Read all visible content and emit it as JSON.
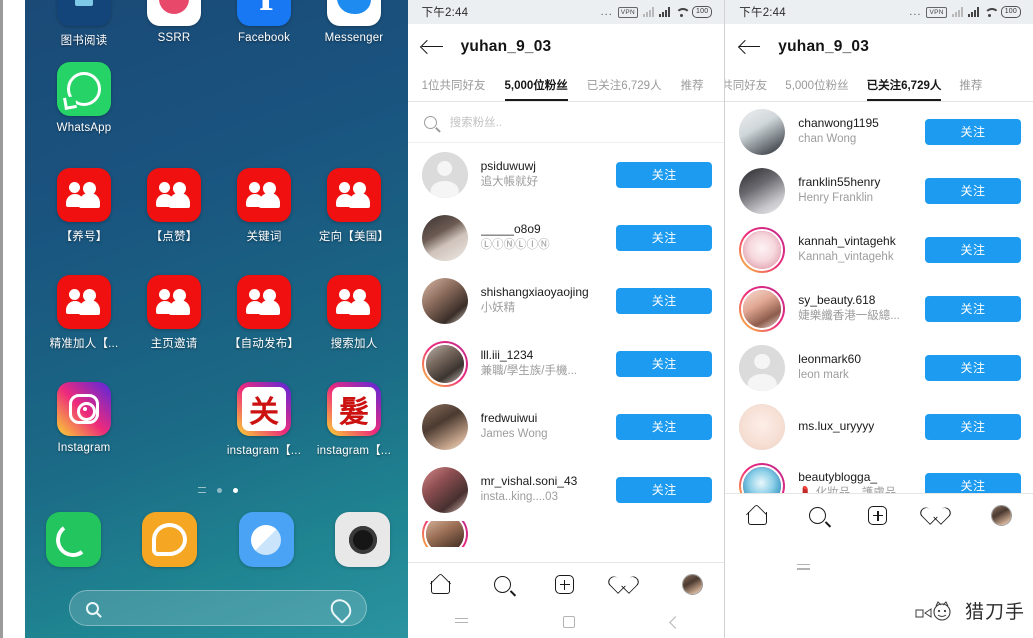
{
  "left_panel": {
    "name": "android-home-screen",
    "wallpaper_color": "#1b4a77",
    "app_rows": [
      [
        {
          "label": "图书阅读",
          "icon": "books-icon"
        },
        {
          "label": "SSRR",
          "icon": "ssrr-icon"
        },
        {
          "label": "Facebook",
          "icon": "facebook-icon"
        },
        {
          "label": "Messenger",
          "icon": "messenger-icon"
        }
      ],
      [
        {
          "label": "WhatsApp",
          "icon": "whatsapp-icon"
        }
      ],
      [
        {
          "label": "【养号】",
          "icon": "users-icon"
        },
        {
          "label": "【点赞】",
          "icon": "users-icon"
        },
        {
          "label": "关键词",
          "icon": "users-icon"
        },
        {
          "label": "定向【美国】",
          "icon": "users-icon"
        }
      ],
      [
        {
          "label": "精准加人【...",
          "icon": "users-icon"
        },
        {
          "label": "主页邀请",
          "icon": "users-icon"
        },
        {
          "label": "【自动发布】",
          "icon": "users-icon"
        },
        {
          "label": "搜索加人",
          "icon": "users-icon"
        }
      ],
      [
        {
          "label": "Instagram",
          "icon": "instagram-icon"
        },
        {
          "label": "",
          "icon": ""
        },
        {
          "label": "instagram【...",
          "icon": "instagram-cn-guan-icon",
          "glyph": "关"
        },
        {
          "label": "instagram【...",
          "icon": "instagram-cn-fa-icon",
          "glyph": "髮"
        }
      ]
    ],
    "dock": [
      {
        "name": "phone-app",
        "icon": "phone-icon"
      },
      {
        "name": "messages-app",
        "icon": "message-bubble-icon"
      },
      {
        "name": "browser-app",
        "icon": "browser-compass-icon"
      },
      {
        "name": "camera-app",
        "icon": "camera-icon"
      }
    ],
    "page_indicator": {
      "pages": 3,
      "active_index": 2
    },
    "search_bar": {
      "icon": "search-icon",
      "assistant_icon": "assistant-icon",
      "placeholder": ""
    }
  },
  "middle_panel": {
    "statusbar": {
      "time": "下午2:44",
      "dots": "...",
      "vpn": "VPN",
      "battery": "100"
    },
    "header": {
      "back_icon": "back-arrow-icon",
      "title": "yuhan_9_03"
    },
    "tabs": [
      {
        "label": "1位共同好友",
        "active": false
      },
      {
        "label": "5,000位粉丝",
        "active": true
      },
      {
        "label": "已关注6,729人",
        "active": false
      },
      {
        "label": "推荐",
        "active": false
      }
    ],
    "search": {
      "placeholder": "搜索粉丝..",
      "value": ""
    },
    "follow_label": "关注",
    "follow_color": "#1d9bf0",
    "users": [
      {
        "username": "psiduwuwj",
        "fullname": "追大帳就好",
        "avatar": "default",
        "ring": false,
        "photo": "ph1"
      },
      {
        "username": "_____o8o9",
        "fullname": "ⓁⒾⓃⓁⒾⓃ",
        "avatar": "photo",
        "ring": false,
        "photo": "ph1"
      },
      {
        "username": "shishangxiaoyaojing",
        "fullname": "小妖精",
        "avatar": "photo",
        "ring": false,
        "photo": "ph3"
      },
      {
        "username": "lll.iii_1234",
        "fullname": "兼職/學生族/手機...",
        "avatar": "photo",
        "ring": true,
        "photo": "ph4"
      },
      {
        "username": "fredwuiwui",
        "fullname": "James Wong",
        "avatar": "photo",
        "ring": false,
        "photo": "ph5"
      },
      {
        "username": "mr_vishal.soni_43",
        "fullname": "insta..king....03",
        "avatar": "photo",
        "ring": false,
        "photo": "ph6"
      },
      {
        "username": "",
        "fullname": "",
        "avatar": "photo",
        "ring": true,
        "photo": "ph7"
      }
    ],
    "bottom_nav": [
      {
        "name": "home",
        "icon": "home-icon"
      },
      {
        "name": "search",
        "icon": "search-icon"
      },
      {
        "name": "add",
        "icon": "plus-square-icon"
      },
      {
        "name": "activity",
        "icon": "heart-icon"
      },
      {
        "name": "profile",
        "icon": "profile-avatar-icon"
      }
    ],
    "android_nav": [
      {
        "name": "recents",
        "icon": "recents-icon"
      },
      {
        "name": "home",
        "icon": "home-square-icon"
      },
      {
        "name": "back",
        "icon": "back-chevron-icon"
      }
    ]
  },
  "right_panel": {
    "statusbar": {
      "time": "下午2:44",
      "dots": "...",
      "vpn": "VPN",
      "battery": "100"
    },
    "header": {
      "back_icon": "back-arrow-icon",
      "title": "yuhan_9_03"
    },
    "tabs": [
      {
        "label": "共同好友",
        "active": false
      },
      {
        "label": "5,000位粉丝",
        "active": false
      },
      {
        "label": "已关注6,729人",
        "active": true
      },
      {
        "label": "推荐",
        "active": false
      }
    ],
    "follow_label": "关注",
    "follow_color": "#1d9bf0",
    "users": [
      {
        "username": "chanwong1195",
        "fullname": "chan Wong",
        "avatar": "photo",
        "ring": false,
        "photo": "ph8"
      },
      {
        "username": "franklin55henry",
        "fullname": "Henry Franklin",
        "avatar": "photo",
        "ring": false,
        "photo": "ph9"
      },
      {
        "username": "kannah_vintagehk",
        "fullname": "Kannah_vintagehk",
        "avatar": "photo",
        "ring": true,
        "photo": "ph10"
      },
      {
        "username": "sy_beauty.618",
        "fullname": "婕樂纖香港一級總...",
        "avatar": "photo",
        "ring": true,
        "photo": "ph11"
      },
      {
        "username": "leonmark60",
        "fullname": "leon mark",
        "avatar": "default",
        "ring": false,
        "photo": "ph12"
      },
      {
        "username": "ms.lux_uryyyy",
        "fullname": "",
        "avatar": "photo",
        "ring": false,
        "photo": "ph12"
      },
      {
        "username": "beautyblogga_",
        "fullname": "💄 化妝品、護膚品...",
        "avatar": "photo",
        "ring": true,
        "photo": "ph13"
      }
    ],
    "bottom_nav": [
      {
        "name": "home",
        "icon": "home-icon"
      },
      {
        "name": "search",
        "icon": "search-icon"
      },
      {
        "name": "add",
        "icon": "plus-square-icon"
      },
      {
        "name": "activity",
        "icon": "heart-icon"
      },
      {
        "name": "profile",
        "icon": "profile-avatar-icon"
      }
    ],
    "android_nav": [
      {
        "name": "recents",
        "icon": "recents-icon"
      }
    ],
    "watermark": {
      "text": "猎刀手",
      "icon": "cat-logo-icon"
    }
  }
}
